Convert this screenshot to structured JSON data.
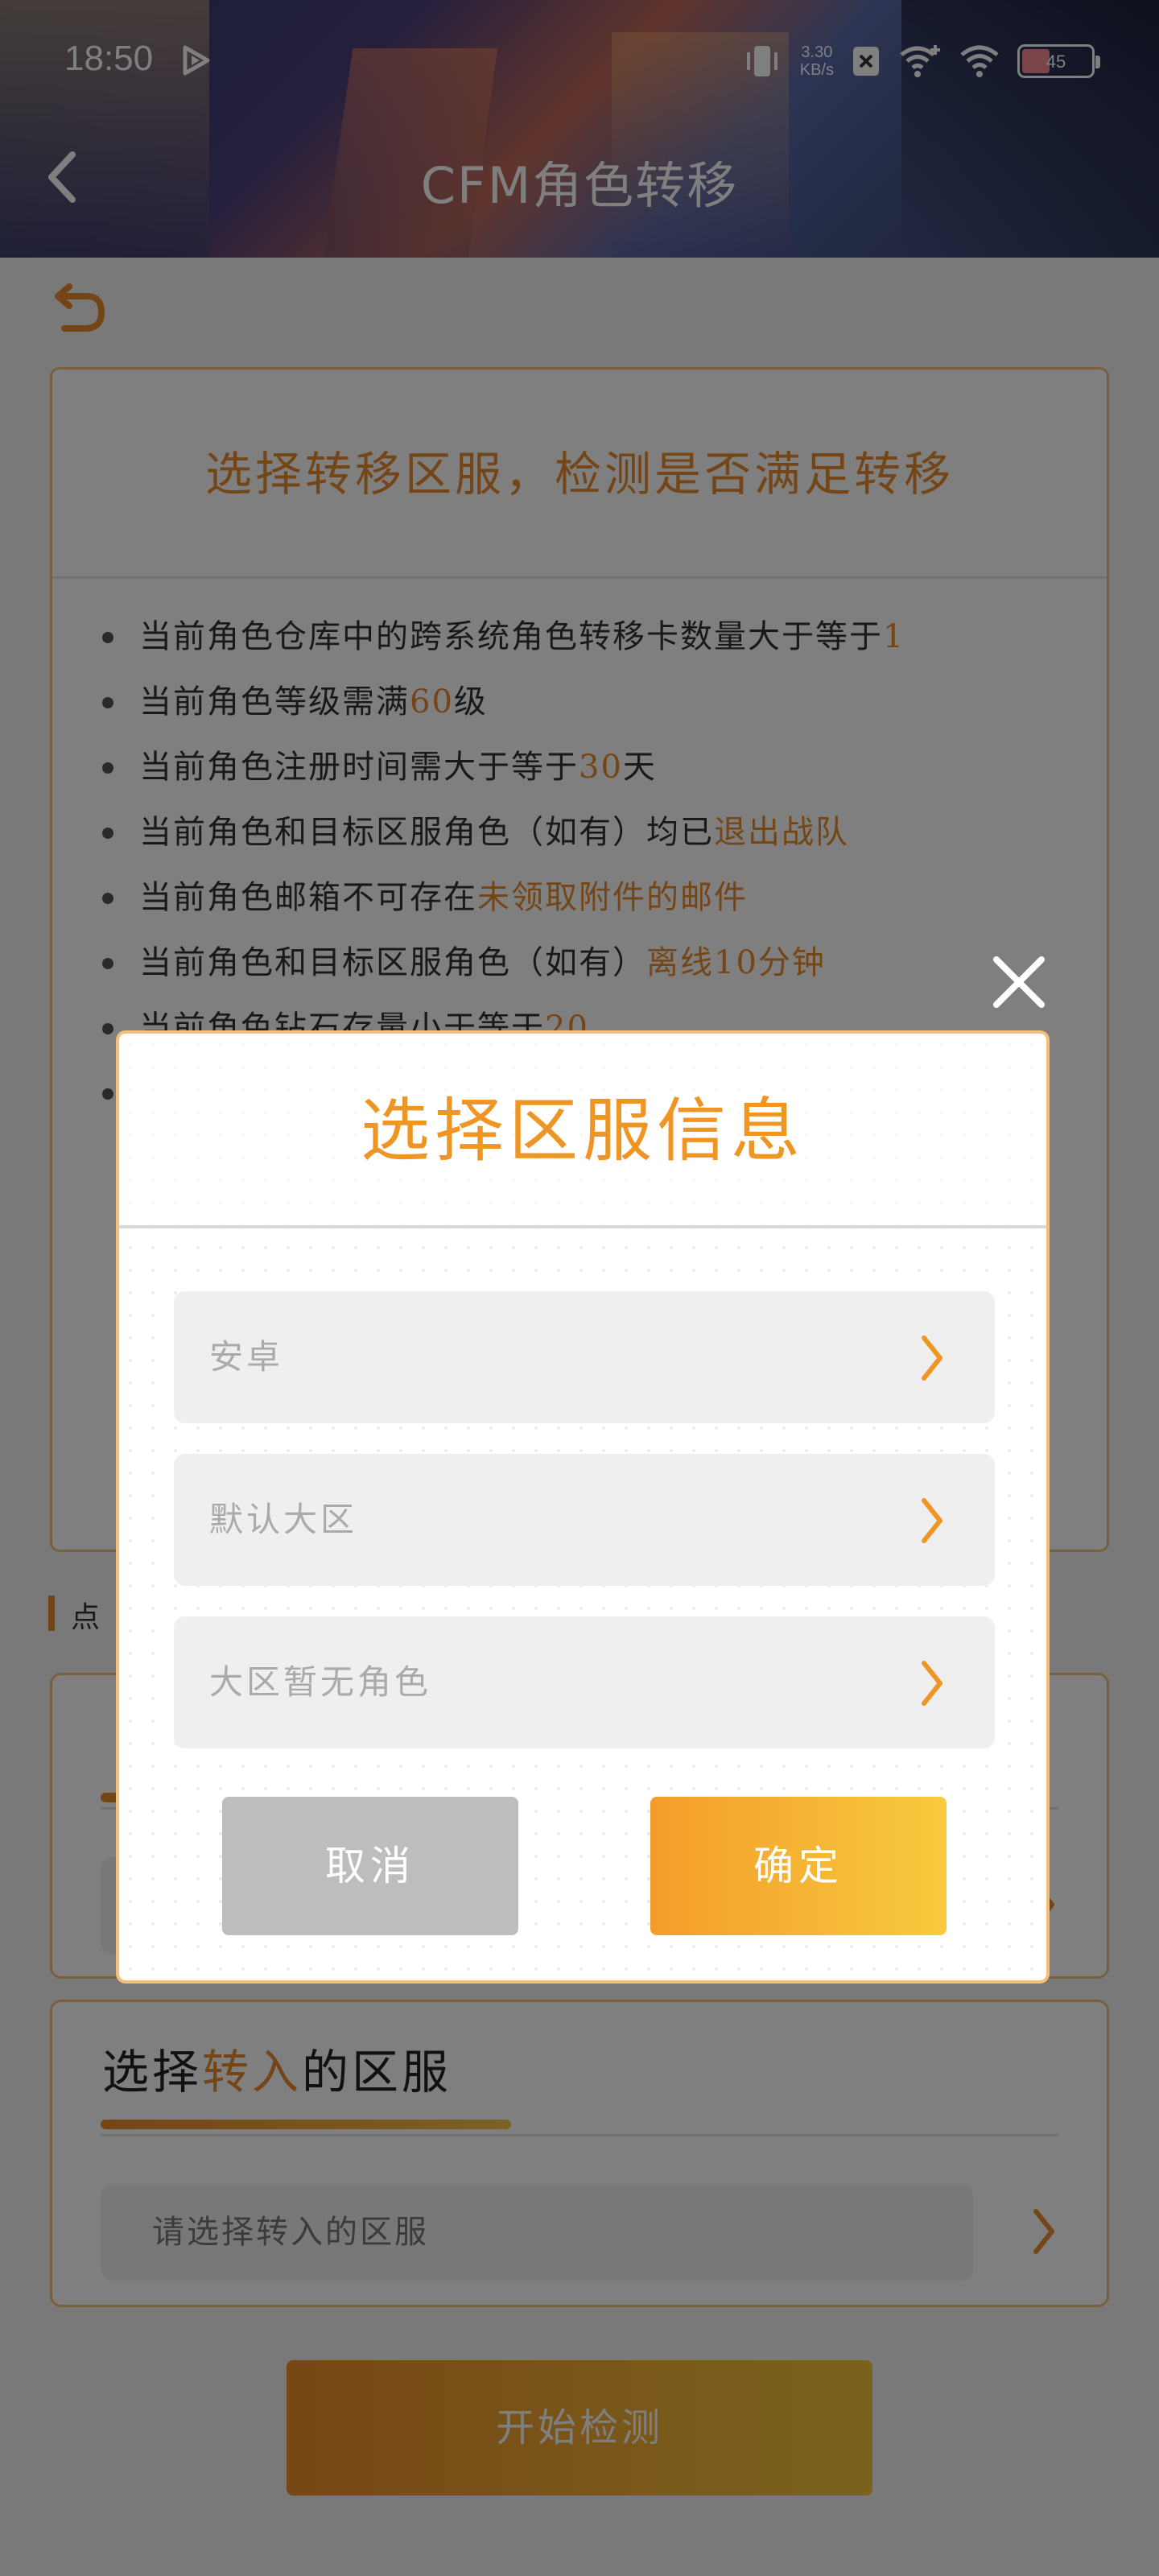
{
  "status_bar": {
    "time": "18:50",
    "speed_value": "3.30",
    "speed_unit": "KB/s",
    "battery": "45"
  },
  "header": {
    "title": "CFM角色转移"
  },
  "rules": {
    "title": "选择转移区服，检测是否满足转移",
    "items": [
      {
        "text": "当前角色仓库中的跨系统角色转移卡数量大于等于",
        "highlight": "1"
      },
      {
        "text": "当前角色等级需满",
        "highlight": "60",
        "suffix": "级"
      },
      {
        "text": "当前角色注册时间需大于等于",
        "highlight": "30",
        "suffix": "天"
      },
      {
        "text": "当前角色和目标区服角色（如有）均已",
        "highlight": "退出战队"
      },
      {
        "text": "当前角色邮箱不可存在",
        "highlight": "未领取附件的邮件"
      },
      {
        "text": "当前角色和目标区服角色（如有）",
        "highlight": "离线10分钟"
      },
      {
        "text": "当前角色钻石存量小于等于",
        "highlight": "20"
      }
    ]
  },
  "tip": {
    "text": "点"
  },
  "transfer_in": {
    "title_prefix": "选择",
    "title_highlight": "转入",
    "title_suffix": "的区服",
    "placeholder": "请选择转入的区服"
  },
  "start_button": {
    "label": "开始检测"
  },
  "modal": {
    "title": "选择区服信息",
    "fields": {
      "platform": "安卓",
      "region": "默认大区",
      "role": "大区暂无角色"
    },
    "cancel_label": "取消",
    "confirm_label": "确定"
  },
  "colors": {
    "accent": "#e88b2c",
    "accent_light": "#f5c449",
    "cancel_gray": "#bdbdbd"
  },
  "icons": [
    "play-icon",
    "vibrate-icon",
    "notification-x-icon",
    "wifi-plus-icon",
    "wifi-icon",
    "battery-icon",
    "back-arrow-icon",
    "undo-icon",
    "close-icon",
    "chevron-right-icon"
  ]
}
